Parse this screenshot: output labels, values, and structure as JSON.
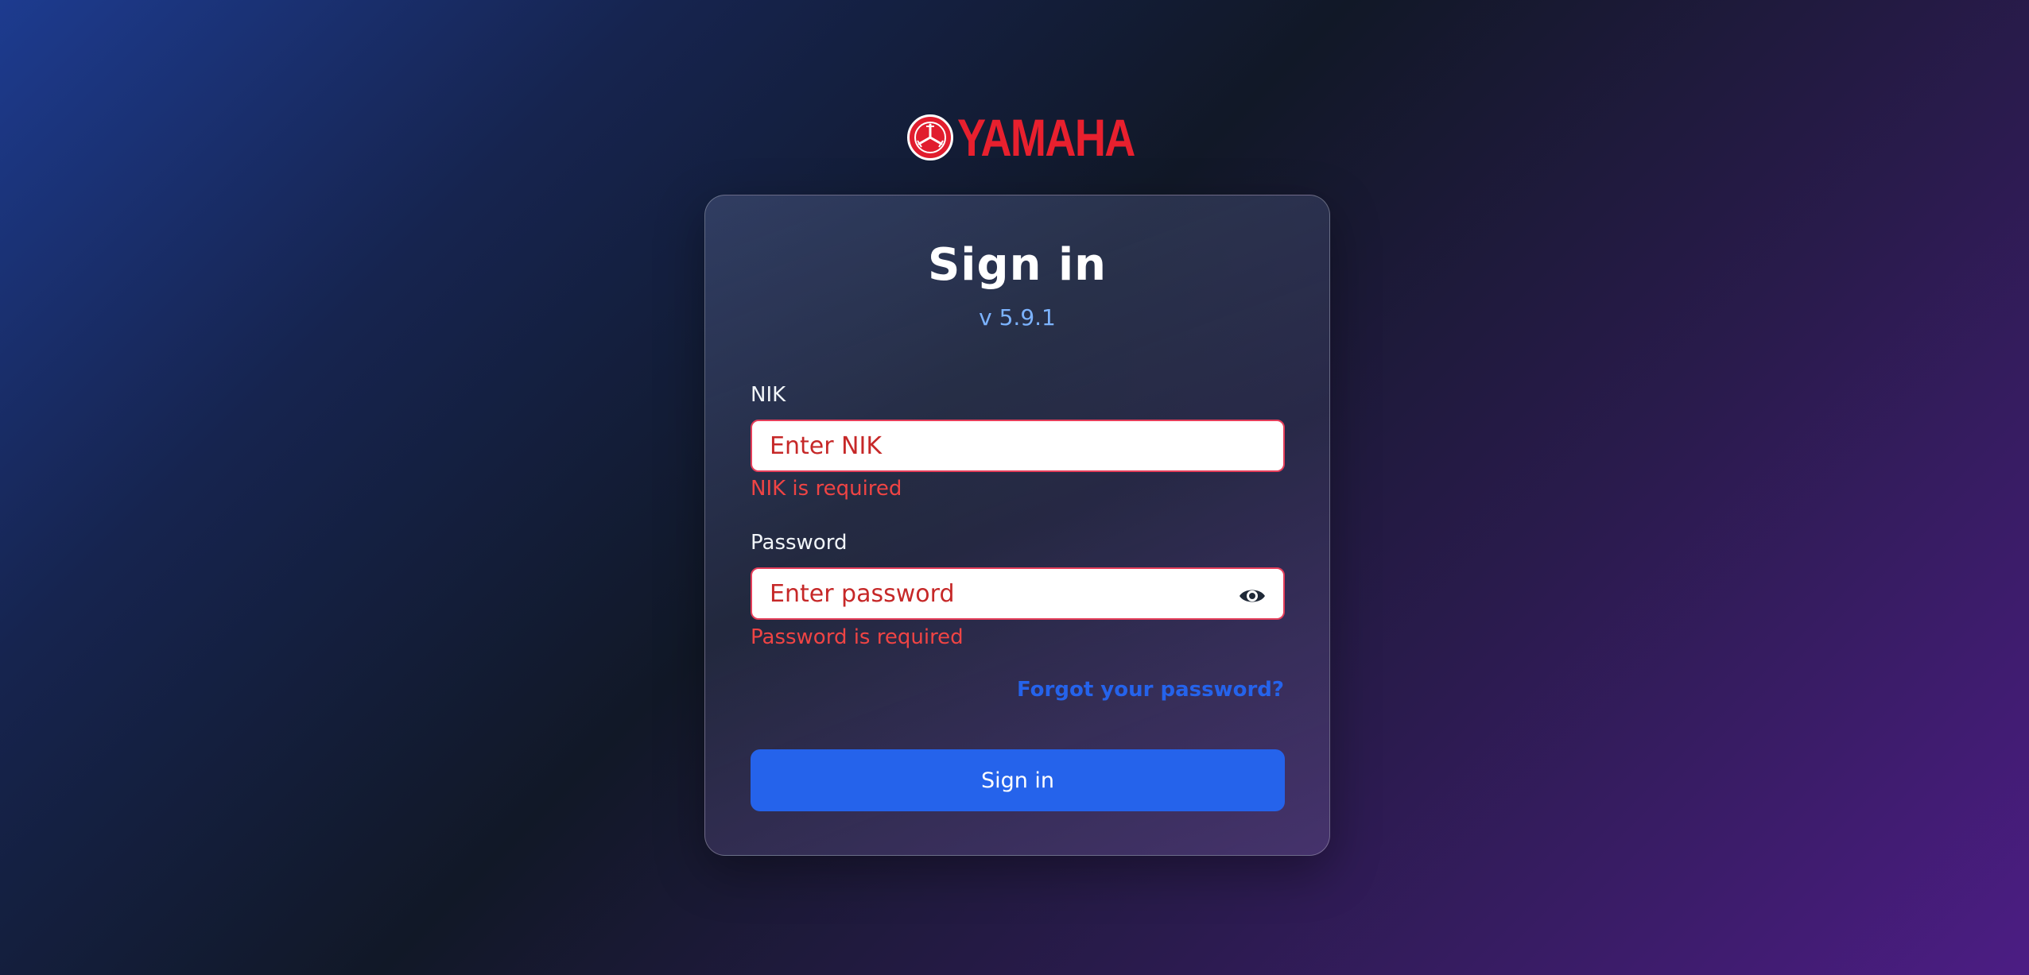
{
  "brand": {
    "logo_text": "YAMAHA",
    "logo_icon": "yamaha-tuning-forks-emblem",
    "color": "#e8202e"
  },
  "card": {
    "title": "Sign in",
    "version": "v 5.9.1"
  },
  "form": {
    "nik": {
      "label": "NIK",
      "placeholder": "Enter NIK",
      "value": "",
      "error": "NIK is required"
    },
    "password": {
      "label": "Password",
      "placeholder": "Enter password",
      "value": "",
      "error": "Password is required",
      "toggle_icon": "eye-icon"
    },
    "forgot_link": "Forgot your password?",
    "submit_label": "Sign in"
  },
  "colors": {
    "accent": "#2563eb",
    "error": "#ef4444",
    "version": "#7cb3ff"
  }
}
